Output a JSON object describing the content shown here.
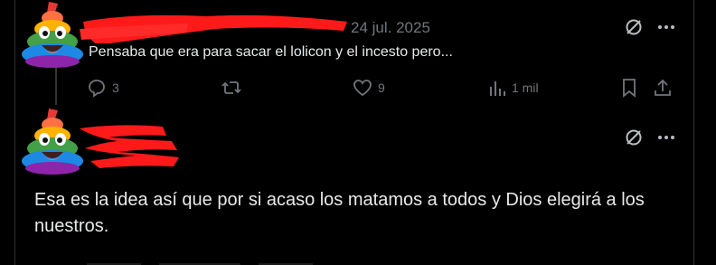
{
  "tweet1": {
    "date": "24 jul. 2025",
    "text": "Pensaba que era para sacar el lolicon y el incesto pero...",
    "actions": {
      "replies": "3",
      "reposts": "",
      "likes": "9",
      "views": "1 mil"
    }
  },
  "tweet2": {
    "text": "Esa es la idea así que por si acaso los matamos a todos y Dios elegirá a los nuestros."
  },
  "colors": {
    "background": "#000000",
    "text": "#e7e9ea",
    "muted": "#71767b",
    "redaction": "#ff1a1a"
  },
  "icons": {
    "menu": "more-icon",
    "grok": "grok-icon",
    "reply": "reply-icon",
    "repost": "repost-icon",
    "like": "heart-icon",
    "views": "analytics-icon",
    "bookmark": "bookmark-icon",
    "share": "share-icon"
  }
}
